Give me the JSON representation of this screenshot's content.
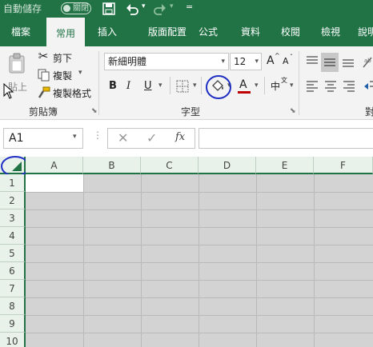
{
  "titlebar": {
    "autosave_label": "自動儲存",
    "autosave_state": "關閉",
    "more_label": "="
  },
  "tabs": [
    {
      "label": "檔案"
    },
    {
      "label": "常用"
    },
    {
      "label": "插入"
    },
    {
      "label": "版面配置"
    },
    {
      "label": "公式"
    },
    {
      "label": "資料"
    },
    {
      "label": "校閱"
    },
    {
      "label": "檢視"
    },
    {
      "label": "說明"
    }
  ],
  "clipboard": {
    "paste_label": "貼上",
    "cut_label": "剪下",
    "copy_label": "複製",
    "format_painter_label": "複製格式",
    "group_label": "剪貼簿"
  },
  "font": {
    "family": "新細明體",
    "size": "12",
    "grow_label": "A",
    "shrink_label": "A",
    "bold": "B",
    "italic": "I",
    "underline": "U",
    "font_color_label": "A",
    "phonetic_label": "中",
    "font_color_hex": "#c00000",
    "group_label": "字型"
  },
  "formula_bar": {
    "name_box": "A1",
    "fx_label": "fx",
    "value": ""
  },
  "grid": {
    "columns": [
      "A",
      "B",
      "C",
      "D",
      "E",
      "F"
    ],
    "rows": [
      "1",
      "2",
      "3",
      "4",
      "5",
      "6",
      "7",
      "8",
      "9",
      "10"
    ],
    "accent": "#217346",
    "highlight_hex": "#1f2fc4"
  }
}
